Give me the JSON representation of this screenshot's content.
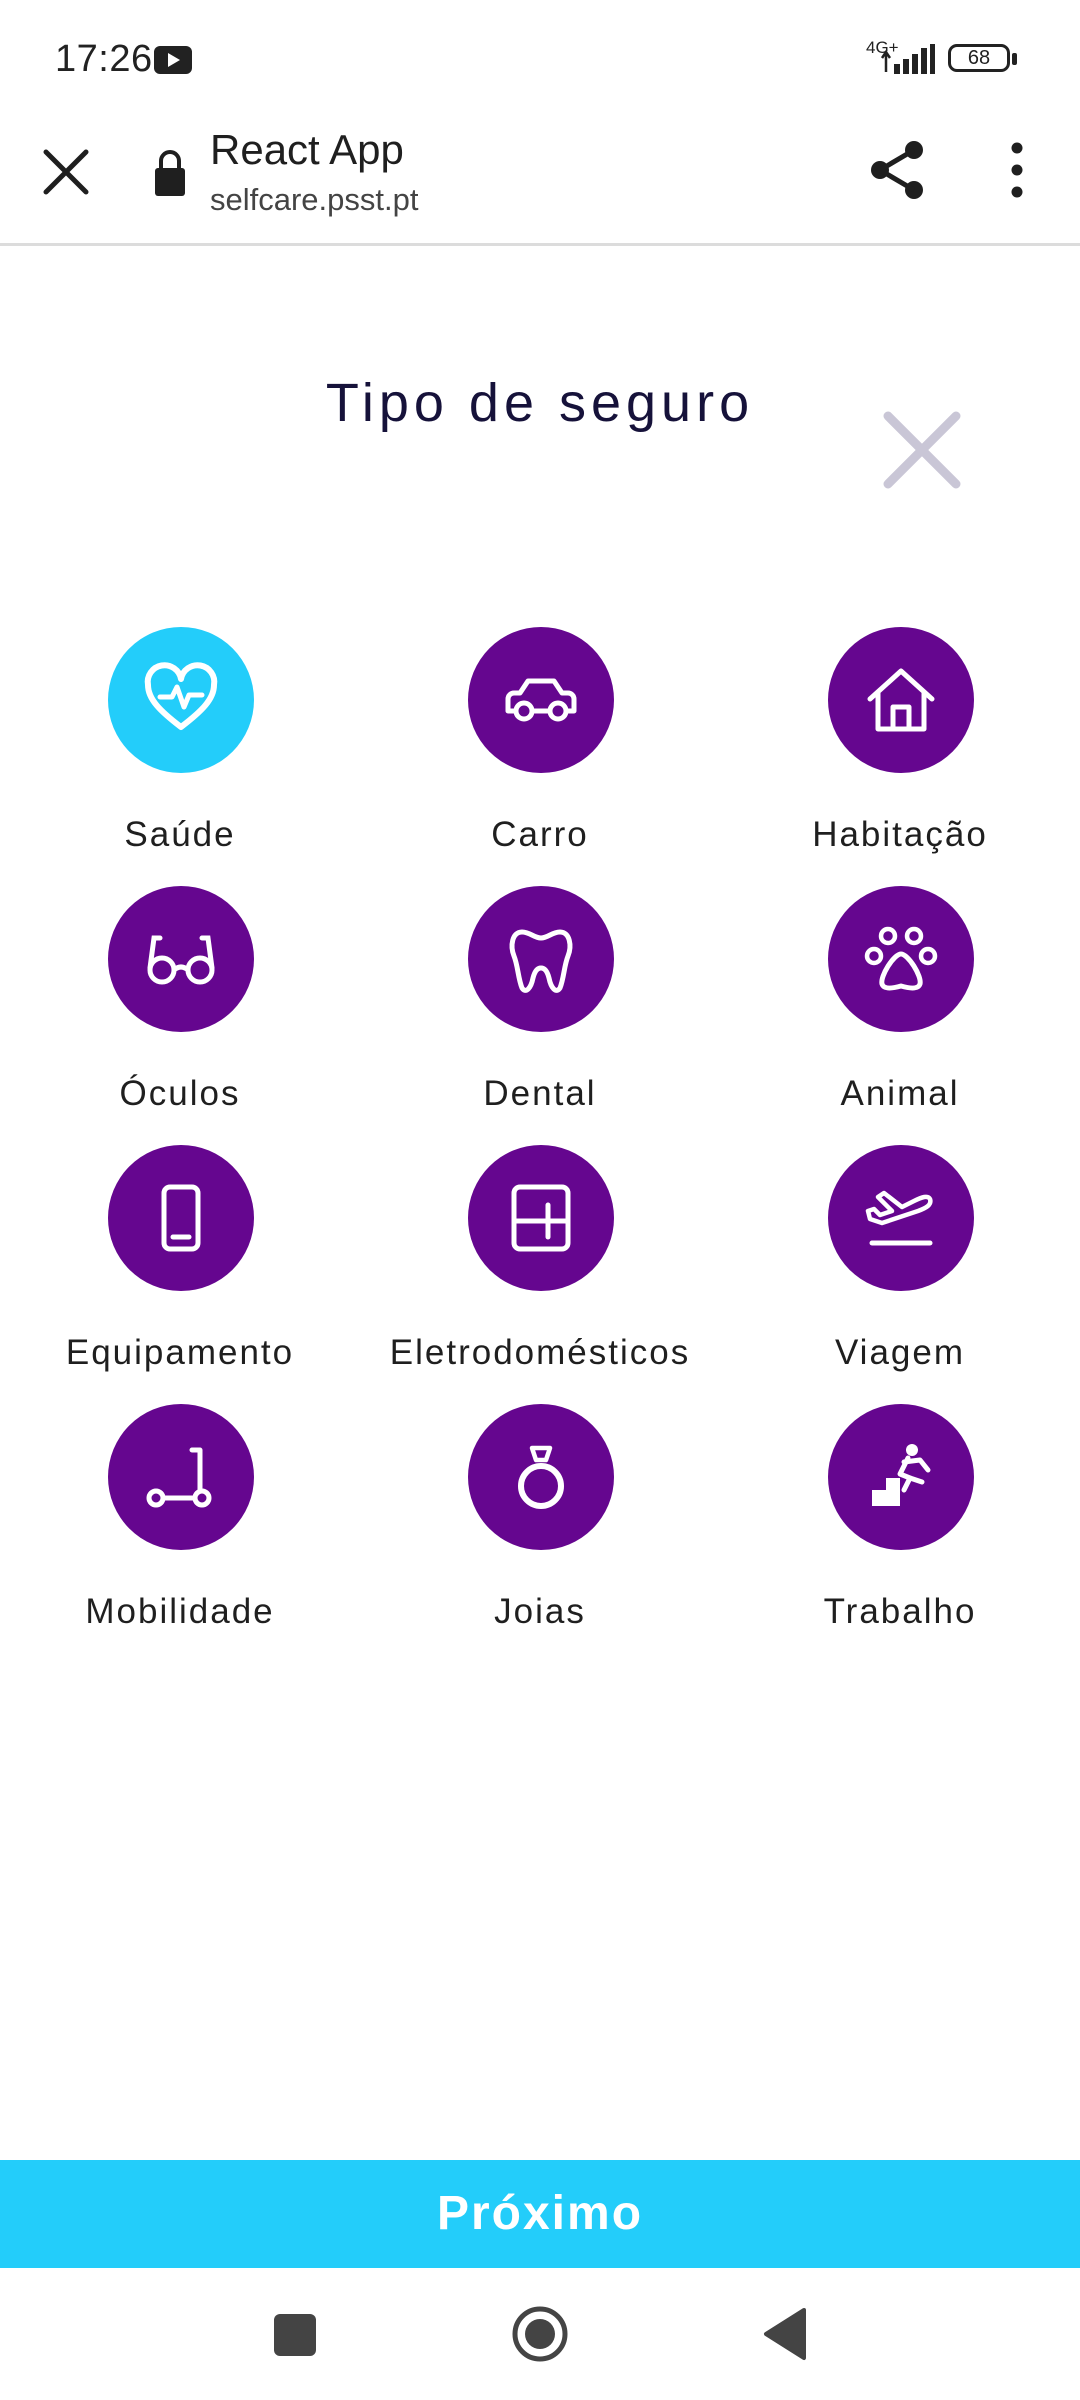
{
  "status_bar": {
    "time": "17:26",
    "network": "4G+",
    "battery": "68"
  },
  "browser": {
    "title": "React App",
    "url": "selfcare.psst.pt"
  },
  "page": {
    "title": "Tipo de seguro"
  },
  "insurance_types": [
    {
      "label": "Saúde",
      "icon": "heart-pulse-icon",
      "selected": true
    },
    {
      "label": "Carro",
      "icon": "car-icon",
      "selected": false
    },
    {
      "label": "Habitação",
      "icon": "house-icon",
      "selected": false
    },
    {
      "label": "Óculos",
      "icon": "glasses-icon",
      "selected": false
    },
    {
      "label": "Dental",
      "icon": "tooth-icon",
      "selected": false
    },
    {
      "label": "Animal",
      "icon": "paw-icon",
      "selected": false
    },
    {
      "label": "Equipamento",
      "icon": "smartphone-icon",
      "selected": false
    },
    {
      "label": "Eletrodomésticos",
      "icon": "appliance-icon",
      "selected": false
    },
    {
      "label": "Viagem",
      "icon": "airplane-icon",
      "selected": false
    },
    {
      "label": "Mobilidade",
      "icon": "scooter-icon",
      "selected": false
    },
    {
      "label": "Joias",
      "icon": "ring-icon",
      "selected": false
    },
    {
      "label": "Trabalho",
      "icon": "work-accident-icon",
      "selected": false
    }
  ],
  "actions": {
    "next_label": "Próximo"
  },
  "colors": {
    "accent": "#23cdfa",
    "primary": "#65068f",
    "title": "#16123a",
    "dismiss": "#c9c6d6"
  }
}
